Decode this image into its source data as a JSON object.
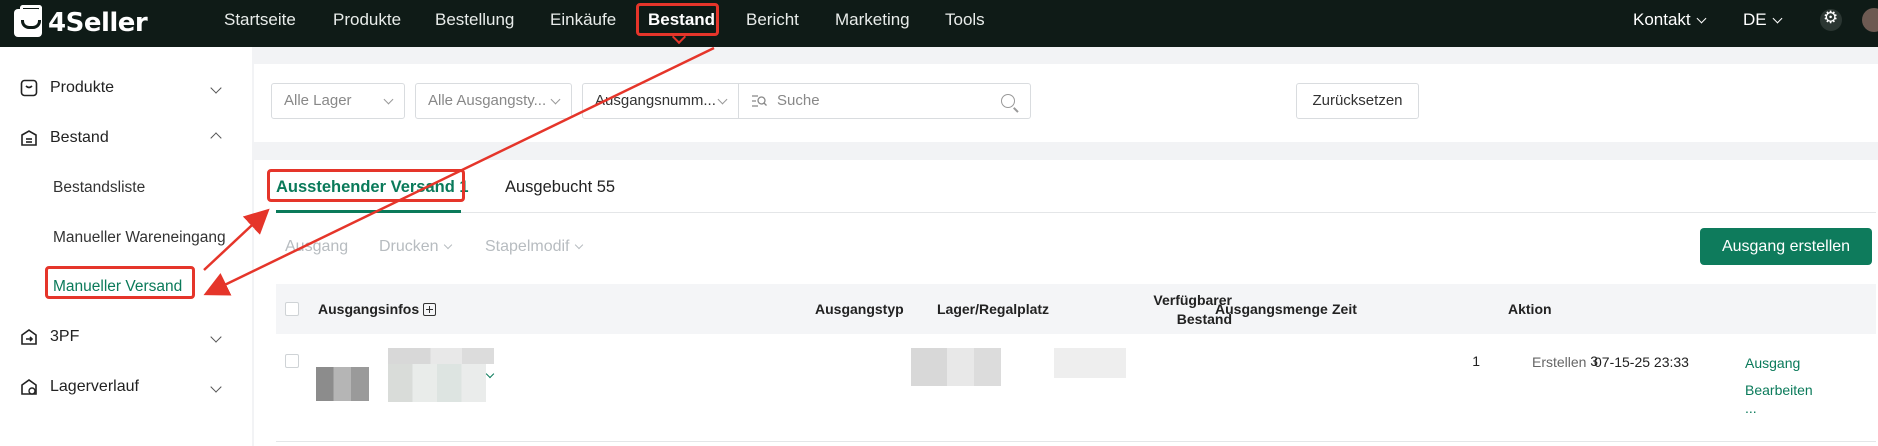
{
  "app": {
    "logo_text": "4Seller"
  },
  "top_nav": {
    "items": [
      "Startseite",
      "Produkte",
      "Bestellung",
      "Einkäufe",
      "Bestand",
      "Bericht",
      "Marketing",
      "Tools"
    ],
    "active": "Bestand",
    "contact": "Kontakt",
    "language": "DE"
  },
  "sidebar": {
    "groups": [
      {
        "label": "Produkte",
        "icon": "product-icon"
      },
      {
        "label": "Bestand",
        "icon": "inventory-icon",
        "expanded": true,
        "children": [
          "Bestandsliste",
          "Manueller Wareneingang",
          "Manueller Versand"
        ],
        "active_child": "Manueller Versand"
      },
      {
        "label": "3PF",
        "icon": "fulfillment-icon"
      },
      {
        "label": "Lagerverlauf",
        "icon": "history-icon"
      }
    ]
  },
  "filters": {
    "warehouse": "Alle Lager",
    "outbound_type": "Alle Ausgangsty...",
    "search_field": "Ausgangsnumm...",
    "search_placeholder": "Suche",
    "reset_label": "Zurücksetzen"
  },
  "tabs": [
    {
      "label": "Ausstehender Versand 1",
      "active": true
    },
    {
      "label": "Ausgebucht 55",
      "active": false
    }
  ],
  "toolbar": {
    "outbound": "Ausgang",
    "print": "Drucken",
    "batch_edit": "Stapelmodif",
    "create_label": "Ausgang erstellen"
  },
  "table": {
    "columns": [
      "Ausgangsinfos",
      "Ausgangstyp",
      "Lager/Regalplatz",
      "Verfügbarer",
      "Bestand",
      "Ausgangsmenge",
      "Zeit",
      "Aktion"
    ],
    "rows": [
      {
        "available_stock": "1",
        "quantity": "3",
        "time_label": "Erstellen",
        "time_value": "07-15-25 23:33",
        "actions": [
          "Ausgang",
          "Bearbeiten",
          "..."
        ]
      }
    ]
  },
  "colors": {
    "topbar_bg": "#0f1b17",
    "brand_green": "#0e7b5c",
    "annotation_red": "#e5352a"
  }
}
